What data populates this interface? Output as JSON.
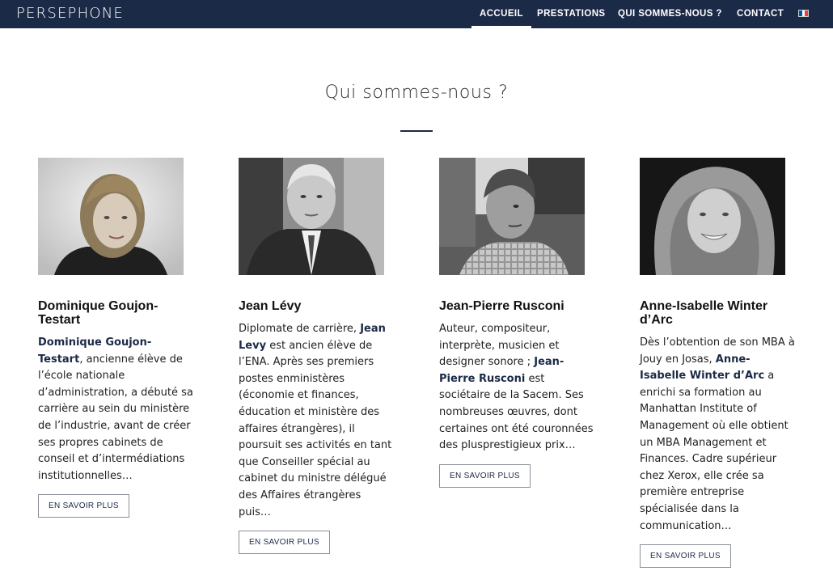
{
  "brand": "PERSEPHONE",
  "nav": {
    "items": [
      {
        "label": "ACCUEIL",
        "active": true
      },
      {
        "label": "PRESTATIONS",
        "active": false
      },
      {
        "label": "QUI SOMMES-NOUS ?",
        "active": false
      },
      {
        "label": "CONTACT",
        "active": false
      }
    ],
    "language_icon": "flag-fr-icon",
    "flag_colors": [
      "#0055a4",
      "#ffffff",
      "#ef4135"
    ]
  },
  "section": {
    "title": "Qui sommes-nous ?"
  },
  "colors": {
    "navy": "#1b2a47",
    "text": "#1f1f1f"
  },
  "team": [
    {
      "name": "Dominique Goujon-Testart",
      "bio_highlight": "Dominique Goujon-Testart",
      "bio_rest": ", ancienne élève de l’école nationale d’administration, a débuté sa carrière au sein du ministère de l’industrie, avant de créer ses propres cabinets de conseil et d’intermédiations institutionnelles…",
      "button": "EN SAVOIR PLUS"
    },
    {
      "name": "Jean Lévy",
      "bio_before": "Diplomate de carrière, ",
      "bio_highlight": "Jean Levy",
      "bio_rest": " est ancien élève de l’ENA. Après ses premiers postes enministères (économie et finances, éducation et ministère des affaires étrangères), il poursuit ses activités en tant que Conseiller spécial au cabinet du ministre délégué des Affaires étrangères puis…",
      "button": "EN SAVOIR PLUS"
    },
    {
      "name": "Jean-Pierre Rusconi",
      "bio_before": "Auteur, compositeur, interprète, musicien et designer sonore ; ",
      "bio_highlight": "Jean-Pierre Rusconi",
      "bio_rest": " est sociétaire de la Sacem. Ses nombreuses œuvres, dont certaines ont été couronnées des plusprestigieux prix…",
      "button": "EN SAVOIR PLUS"
    },
    {
      "name": "Anne-Isabelle Winter d’Arc",
      "bio_before": "Dès l’obtention de son MBA à Jouy en Josas, ",
      "bio_highlight": "Anne-Isabelle Winter d’Arc",
      "bio_rest": " a enrichi sa formation au Manhattan Institute of Management où elle obtient un MBA Management et Finances. Cadre supérieur chez Xerox, elle crée sa première entreprise spécialisée dans la communication…",
      "button": "EN SAVOIR PLUS"
    }
  ]
}
